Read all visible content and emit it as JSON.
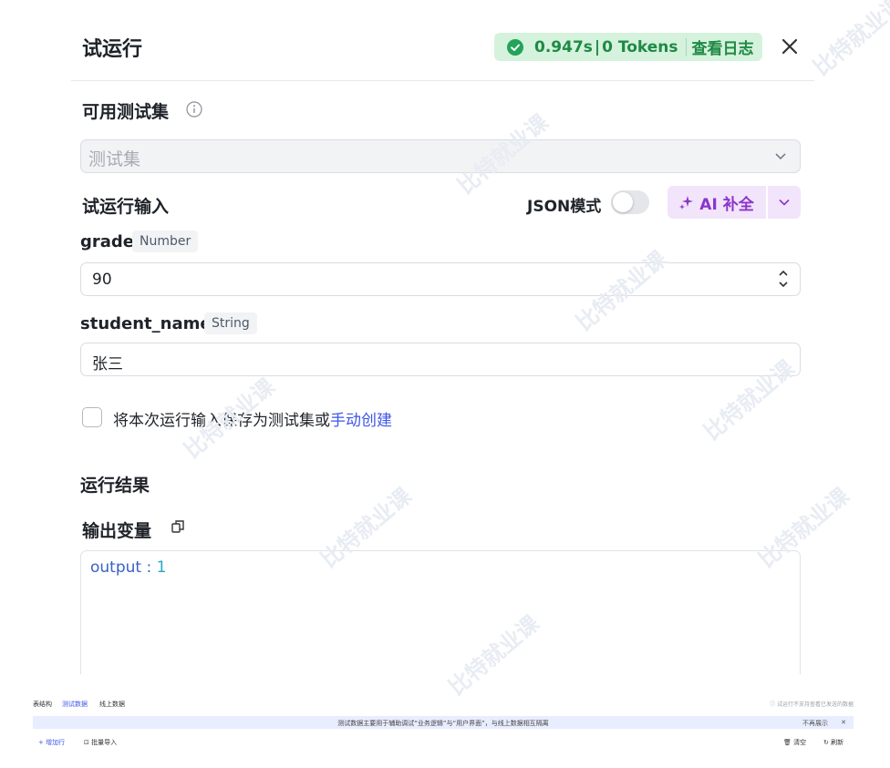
{
  "dialog": {
    "title": "试运行",
    "status": {
      "time": "0.947s",
      "separator": "|",
      "tokens": "0 Tokens",
      "log_link": "查看日志"
    },
    "test_set": {
      "label": "可用测试集",
      "placeholder": "测试集"
    },
    "input_section": {
      "label": "试运行输入",
      "json_mode_label": "JSON模式",
      "json_mode_enabled": false,
      "ai_button_label": "AI 补全"
    },
    "fields": [
      {
        "name": "grade",
        "type": "Number",
        "value": "90"
      },
      {
        "name": "student_name",
        "type": "String",
        "value": "张三"
      }
    ],
    "save_option": {
      "text": "将本次运行输入保存为测试集或",
      "link": "手动创建",
      "checked": false
    },
    "result": {
      "label": "运行结果",
      "output_label": "输出变量",
      "output_key": "output",
      "output_colon": " : ",
      "output_value": "1"
    }
  },
  "bottom_bar": {
    "tabs": [
      "表结构",
      "测试数据",
      "线上数据"
    ],
    "active_tab": "测试数据",
    "right_tip": "ⓘ 试运行不支持查看已发送的数据",
    "info_text": "测试数据主要用于辅助调试“业务逻辑”与“用户界面”，与线上数据相互隔离",
    "info_dismiss": "不再展示",
    "info_close": "✕",
    "add_row": "+ 增加行",
    "batch_import": "⊡ 批量导入",
    "clear": "🗑 清空",
    "refresh": "↻ 刷新"
  },
  "watermark": "比特就业课",
  "colors": {
    "status_bg": "#d5f2dd",
    "status_text": "#1f8a45",
    "ai_bg": "#f1e4fb",
    "ai_text": "#8a35c9",
    "link": "#3d56e8"
  }
}
